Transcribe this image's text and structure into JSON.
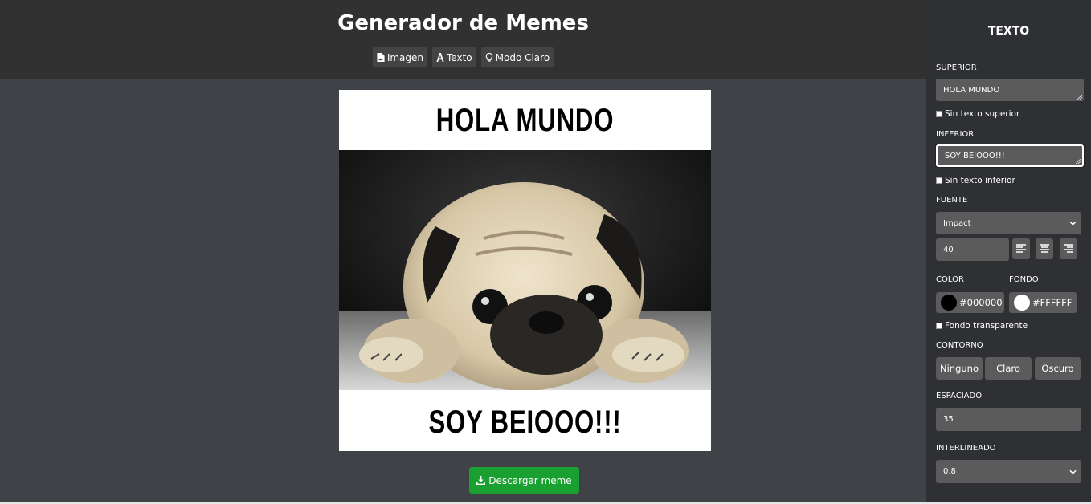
{
  "header": {
    "title": "Generador de Memes",
    "tabs": [
      {
        "label": "Imagen",
        "icon": "file-image-icon"
      },
      {
        "label": "Texto",
        "icon": "font-icon"
      },
      {
        "label": "Modo Claro",
        "icon": "lightbulb-icon"
      }
    ]
  },
  "meme": {
    "top_text": "HOLA MUNDO",
    "bottom_text": "SOY BEIOOO!!!",
    "image": "pug-photo"
  },
  "download": {
    "label": "Descargar meme",
    "icon": "download-icon",
    "color": "#1aa031"
  },
  "sidebar": {
    "title": "TEXTO",
    "superior": {
      "label": "SUPERIOR",
      "value": "HOLA MUNDO",
      "checkbox": "Sin texto superior"
    },
    "inferior": {
      "label": "INFERIOR",
      "value": "SOY BEIOOO!!!",
      "checkbox": "Sin texto inferior"
    },
    "fuente": {
      "label": "FUENTE",
      "value": "Impact",
      "size": "40"
    },
    "color": {
      "label": "COLOR",
      "value": "#000000"
    },
    "fondo": {
      "label": "FONDO",
      "value": "#FFFFFF"
    },
    "transparente": "Fondo transparente",
    "contorno": {
      "label": "CONTORNO",
      "options": [
        "Ninguno",
        "Claro",
        "Oscuro"
      ]
    },
    "espaciado": {
      "label": "ESPACIADO",
      "value": "35"
    },
    "interlineado": {
      "label": "INTERLINEADO",
      "value": "0.8"
    }
  }
}
